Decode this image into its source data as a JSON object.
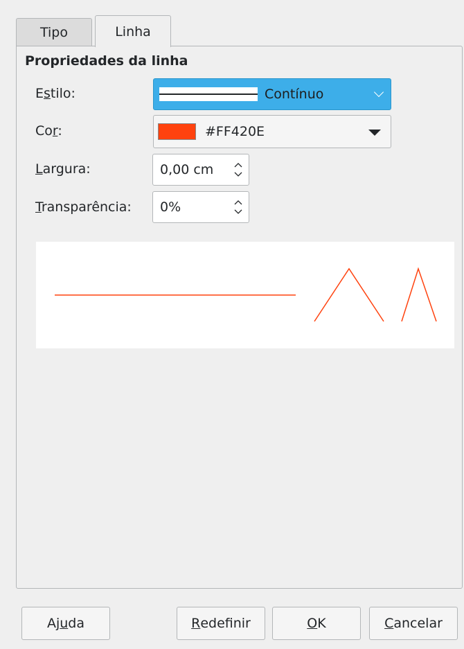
{
  "tabs": [
    {
      "label": "Tipo",
      "active": false
    },
    {
      "label": "Linha",
      "active": true
    }
  ],
  "section_title": "Propriedades da linha",
  "fields": {
    "style": {
      "label_pre": "E",
      "label_mn": "s",
      "label_post": "tilo:",
      "value": "Contínuo"
    },
    "color": {
      "label_pre": "Co",
      "label_mn": "r",
      "label_post": ":",
      "value": "#FF420E",
      "swatch": "#FF420E"
    },
    "width": {
      "label_mn": "L",
      "label_post": "argura:",
      "value": "0,00 cm"
    },
    "transparency": {
      "label_mn": "T",
      "label_post": "ransparência:",
      "value": "0%"
    }
  },
  "preview_color": "#FF420E",
  "buttons": {
    "help": {
      "pre": "Aj",
      "mn": "u",
      "post": "da"
    },
    "reset": {
      "pre": "",
      "mn": "R",
      "post": "edefinir"
    },
    "ok": {
      "pre": "",
      "mn": "O",
      "post": "K"
    },
    "cancel": {
      "pre": "",
      "mn": "C",
      "post": "ancelar"
    }
  },
  "colors": {
    "accent": "#3daee9",
    "line": "#FF420E"
  }
}
